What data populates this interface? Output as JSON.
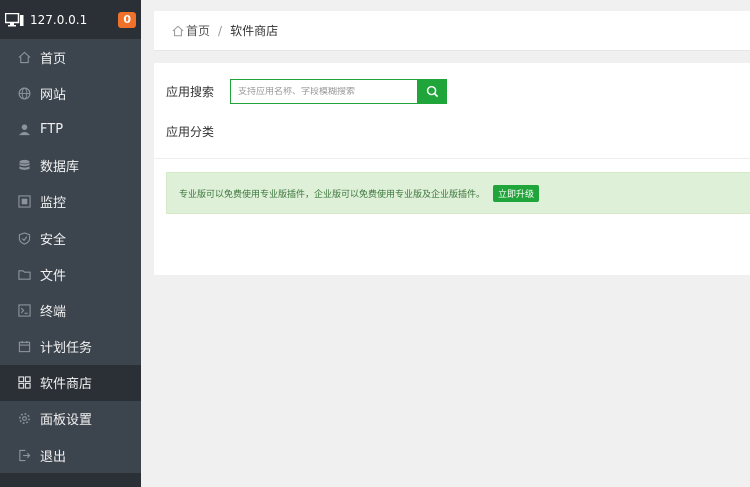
{
  "sidebar": {
    "host": "127.0.0.1",
    "badge": "0",
    "items": [
      {
        "label": "首页",
        "icon": "home-icon"
      },
      {
        "label": "网站",
        "icon": "globe-icon"
      },
      {
        "label": "FTP",
        "icon": "ftp-icon"
      },
      {
        "label": "数据库",
        "icon": "database-icon"
      },
      {
        "label": "监控",
        "icon": "monitor-icon"
      },
      {
        "label": "安全",
        "icon": "shield-icon"
      },
      {
        "label": "文件",
        "icon": "folder-icon"
      },
      {
        "label": "终端",
        "icon": "terminal-icon"
      },
      {
        "label": "计划任务",
        "icon": "calendar-icon"
      },
      {
        "label": "软件商店",
        "icon": "grid-icon",
        "active": true
      },
      {
        "label": "面板设置",
        "icon": "gear-icon"
      },
      {
        "label": "退出",
        "icon": "logout-icon"
      }
    ]
  },
  "breadcrumb": {
    "home": "首页",
    "separator": "/",
    "current": "软件商店"
  },
  "search": {
    "label": "应用搜索",
    "placeholder": "支持应用名称、字段模糊搜索"
  },
  "category": {
    "label": "应用分类"
  },
  "notice": {
    "text": "专业版可以免费使用专业版插件，企业版可以免费使用专业版及企业版插件。",
    "button": "立即升级"
  },
  "colors": {
    "accent": "#20a53a",
    "sidebar_bg": "#3c444d",
    "badge": "#f0712a",
    "notice_bg": "#dff0d8"
  }
}
